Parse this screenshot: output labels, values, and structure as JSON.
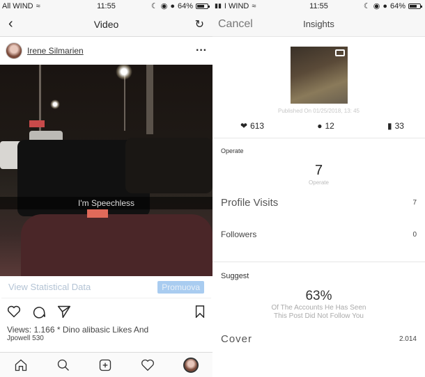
{
  "left": {
    "status": {
      "carrier": "All WIND",
      "time": "11:55",
      "battery": "64%"
    },
    "nav": {
      "title": "Video"
    },
    "post": {
      "username": "Irene Silmarien",
      "caption_text": "I'm Speechless",
      "view_stats_label": "View Statistical Data",
      "promote_label": "Promuova",
      "views_line": "Views: 1.166 * Dino alibasic Likes And",
      "views_line2": "Jpowell 530"
    },
    "icons": [
      "back-icon",
      "refresh-icon",
      "more-icon",
      "heart-icon",
      "comment-icon",
      "share-icon",
      "bookmark-icon",
      "home-icon",
      "search-icon",
      "add-icon",
      "activity-icon",
      "profile-icon"
    ]
  },
  "right": {
    "status": {
      "carrier": "I WIND",
      "time": "11:55",
      "battery": "64%"
    },
    "nav": {
      "cancel_label": "Cancel",
      "title": "Insights"
    },
    "published": "Published On 01/25/2018, 13: 45",
    "counts": {
      "likes": "613",
      "comments": "12",
      "saves": "33"
    },
    "operate": {
      "section_title": "Operate",
      "value": "7",
      "sub_label": "Operate",
      "rows": [
        {
          "label": "Profile Visits",
          "value": "7"
        },
        {
          "label": "Followers",
          "value": "0"
        }
      ]
    },
    "suggest": {
      "section_title": "Suggest",
      "percent": "63%",
      "desc_line1": "Of The Accounts He Has Seen",
      "desc_line2": "This Post Did Not Follow You",
      "rows": [
        {
          "label": "Cover",
          "value": "2.014"
        }
      ]
    }
  }
}
